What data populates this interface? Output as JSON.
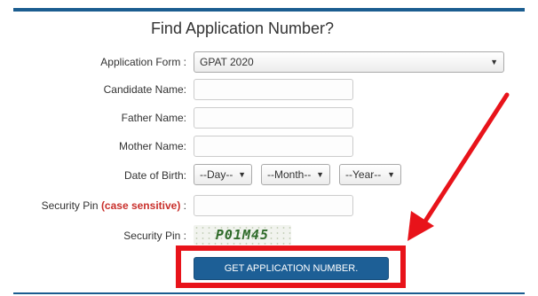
{
  "page_title": "Find Application Number?",
  "form": {
    "application_form": {
      "label": "Application Form :",
      "selected": "GPAT 2020"
    },
    "candidate_name": {
      "label": "Candidate Name:",
      "value": ""
    },
    "father_name": {
      "label": "Father Name:",
      "value": ""
    },
    "mother_name": {
      "label": "Mother Name:",
      "value": ""
    },
    "dob": {
      "label": "Date of Birth:",
      "day": "--Day--",
      "month": "--Month--",
      "year": "--Year--"
    },
    "security_pin_input": {
      "label_prefix": "Security Pin ",
      "label_case": "(case sensitive)",
      "label_suffix": " :",
      "value": ""
    },
    "security_pin_image": {
      "label": "Security Pin :",
      "code": "P01M45"
    },
    "submit_label": "GET APPLICATION NUMBER."
  },
  "colors": {
    "brand_blue": "#1d5f96",
    "annotation_red": "#e8131a",
    "case_red": "#c9302c"
  },
  "icons": {
    "select_caret": "caret-down-icon",
    "annotation": "red-arrow-icon"
  }
}
